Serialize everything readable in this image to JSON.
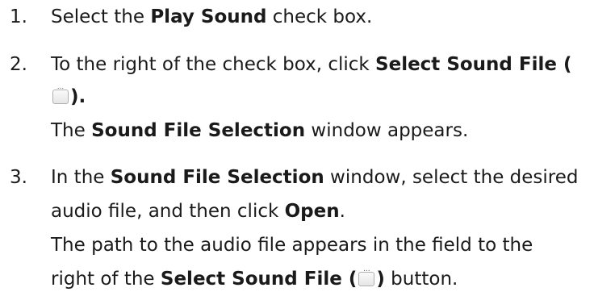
{
  "steps": [
    {
      "number": "1.",
      "lines": [
        {
          "a": "Select the ",
          "b": "Play Sound",
          "c": " check box."
        }
      ]
    },
    {
      "number": "2.",
      "lines": [
        {
          "a": "To the right of the check box, click ",
          "b": "Select Sound File ("
        },
        {
          "c": ")."
        },
        {
          "a": "The ",
          "b": "Sound File Selection",
          "c": " window appears."
        }
      ]
    },
    {
      "number": "3.",
      "lines": [
        {
          "a": "In the ",
          "b": "Sound File Selection",
          "c": " window, select the desired"
        },
        {
          "a": "audio file, and then click ",
          "b": "Open",
          "c": "."
        },
        {
          "a": "The path to the audio file appears in the field to the"
        },
        {
          "a": "right of the ",
          "b": "Select Sound File (",
          "c": ") button."
        }
      ]
    }
  ],
  "icons": {
    "select_sound_file_button": "ellipsis-button-icon"
  }
}
